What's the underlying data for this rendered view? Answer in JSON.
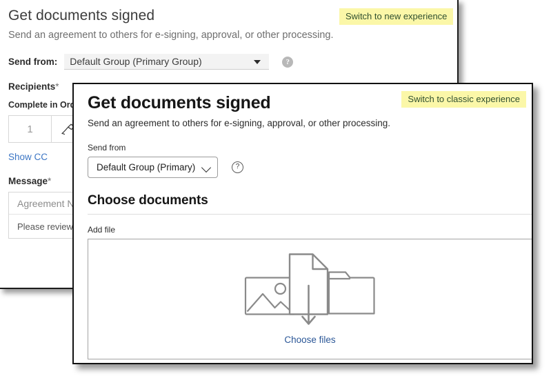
{
  "classic": {
    "title": "Get documents signed",
    "subtitle": "Send an agreement to others for e-signing, approval, or other processing.",
    "switch_button": "Switch to new experience",
    "send_from_label": "Send from:",
    "send_from_value": "Default Group (Primary Group)",
    "help_icon_glyph": "?",
    "recipients_label": "Recipients",
    "required_mark": "*",
    "complete_in_order_label": "Complete in Order",
    "recipient_number": "1",
    "show_cc": "Show CC",
    "message_label": "Message",
    "agreement_name_placeholder": "Agreement N",
    "message_body": "Please review a"
  },
  "modal": {
    "title": "Get documents signed",
    "subtitle": "Send an agreement to others for e-signing, approval, or other processing.",
    "switch_button": "Switch to classic experience",
    "send_from_label": "Send from",
    "send_from_value": "Default Group (Primary)",
    "help_icon_glyph": "?",
    "section_title": "Choose documents",
    "add_file_label": "Add file",
    "choose_files_link": "Choose files"
  },
  "colors": {
    "highlight_yellow": "#fbf7a8",
    "link_blue": "#2b5797",
    "classic_link_blue": "#3b75c4",
    "border_dark": "#111111",
    "dropzone_border": "#a3a3a3",
    "icon_gray": "#8a8a8a"
  }
}
